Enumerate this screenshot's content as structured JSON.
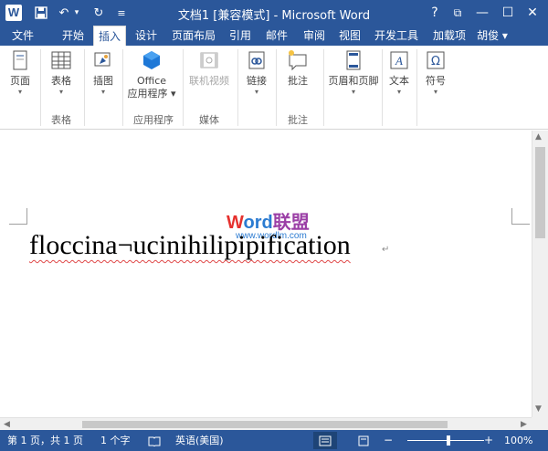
{
  "titlebar": {
    "app_logo": "W",
    "title": "文档1 [兼容模式] - Microsoft Word",
    "help": "?",
    "restore": "⧉",
    "minimize": "—",
    "maximize": "☐",
    "close": "✕",
    "qa_save": "💾",
    "qa_undo": "↶",
    "qa_undo_arrow": "▾",
    "qa_redo": "↻",
    "qa_customize": "≡"
  },
  "tabs": {
    "file": "文件",
    "home": "开始",
    "insert": "插入",
    "design": "设计",
    "layout": "页面布局",
    "references": "引用",
    "mailings": "邮件",
    "review": "审阅",
    "view": "视图",
    "developer": "开发工具",
    "addins": "加载项",
    "user": "胡俊"
  },
  "ribbon": {
    "pages": "页面",
    "table": "表格",
    "illustrations": "插图",
    "office_line1": "Office",
    "office_line2": "应用程序",
    "online_video": "联机视频",
    "links": "链接",
    "comment": "批注",
    "header_footer": "页眉和页脚",
    "text": "文本",
    "symbols": "符号",
    "arrow": "▾",
    "groups": {
      "tables": "表格",
      "apps": "应用程序",
      "media": "媒体",
      "comments": "批注"
    },
    "collapse": "▲"
  },
  "watermark": {
    "w1": "W",
    "w2": "ord",
    "w3": "联盟",
    "url": "www.wordlm.com"
  },
  "document": {
    "text": "floccina¬ucinihilipipification",
    "pilcrow": "↵"
  },
  "statusbar": {
    "page": "第 1 页，共 1 页",
    "words": "1 个字",
    "proofing_icon": "📖",
    "language": "英语(美国)",
    "zoom_minus": "−",
    "zoom_plus": "+",
    "zoom": "100%",
    "zoom_percent": 100
  },
  "colors": {
    "brand": "#2b579a",
    "statusbar_active": "#1e4477",
    "watermark_red": "#e6312e",
    "watermark_blue": "#2b7bd1",
    "watermark_purple": "#9b3fa6"
  }
}
